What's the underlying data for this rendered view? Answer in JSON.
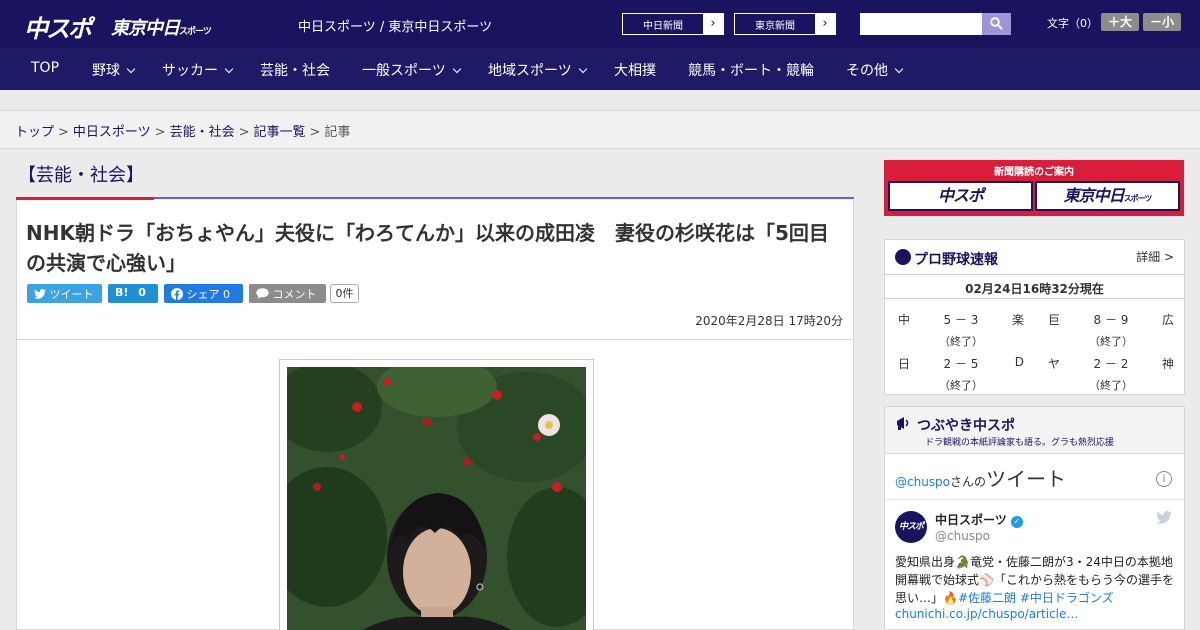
{
  "header": {
    "logo_main": "中スポ",
    "logo_tokyo": "東京中日",
    "logo_tokyo_small": "スポーツ",
    "site_title": "中日スポーツ / 東京中日スポーツ",
    "ext_links": [
      {
        "label": "中日新聞"
      },
      {
        "label": "東京新聞"
      }
    ],
    "search": {
      "placeholder": ""
    },
    "font_size_label": "文字（0）",
    "font_bigger": "＋大",
    "font_smaller": "－小"
  },
  "nav": {
    "items": [
      {
        "label": "TOP"
      },
      {
        "label": "野球"
      },
      {
        "label": "サッカー"
      },
      {
        "label": "芸能・社会"
      },
      {
        "label": "一般スポーツ"
      },
      {
        "label": "地域スポーツ"
      },
      {
        "label": "大相撲"
      },
      {
        "label": "競馬・ボート・競輪"
      },
      {
        "label": "その他"
      }
    ]
  },
  "breadcrumb": {
    "items": [
      "トップ",
      "中日スポーツ",
      "芸能・社会",
      "記事一覧"
    ],
    "current": "記事"
  },
  "article": {
    "category": "【芸能・社会】",
    "title": "NHK朝ドラ「おちょやん」夫役に「わろてんか」以来の成田凌　妻役の杉咲花は「5回目の共演で心強い」",
    "share": {
      "tweet": "ツイート",
      "hatena_label": "B!",
      "hatena_count": "0",
      "facebook": "シェア",
      "facebook_count": "0",
      "comment": "コメント",
      "comment_count": "0件"
    },
    "date": "2020年2月28日 17時20分"
  },
  "sidebar": {
    "subscribe_title": "新聞購読のご案内",
    "subscribe_logos": [
      "中スポ",
      "東京中日"
    ],
    "subscribe_small": "スポーツ",
    "baseball": {
      "title": "プロ野球速報",
      "detail": "詳細 >",
      "updated": "02月24日16時32分現在",
      "games": [
        {
          "home": "中",
          "score": "5 － 3",
          "away": "楽",
          "status": "（終了）"
        },
        {
          "home": "巨",
          "score": "8 － 9",
          "away": "広",
          "status": "（終了）"
        },
        {
          "home": "日",
          "score": "2 － 5",
          "away": "D",
          "status": "（終了）"
        },
        {
          "home": "ヤ",
          "score": "2 － 2",
          "away": "神",
          "status": "（終了）"
        }
      ]
    },
    "tsubuyaki": {
      "title": "つぶやき中スポ",
      "subtitle": "ドラ観戦の本紙評論家も語る。グラも熱烈応援",
      "handle_link": "@chuspo",
      "handle_suffix": "さんの",
      "tweets_label": "ツイート",
      "info": "i",
      "tweet": {
        "avatar": "中スポ",
        "name": "中日スポーツ",
        "verified": "✓",
        "handle": "@chuspo",
        "text": "愛知県出身🐊竜党・佐藤二朗が3・24中日の本拠地開幕戦で始球式⚾「これから熱をもらう今の選手を思い…」🔥",
        "tags": "#佐藤二朗 #中日ドラゴンズ",
        "url": "chunichi.co.jp/chuspo/article…"
      }
    }
  }
}
